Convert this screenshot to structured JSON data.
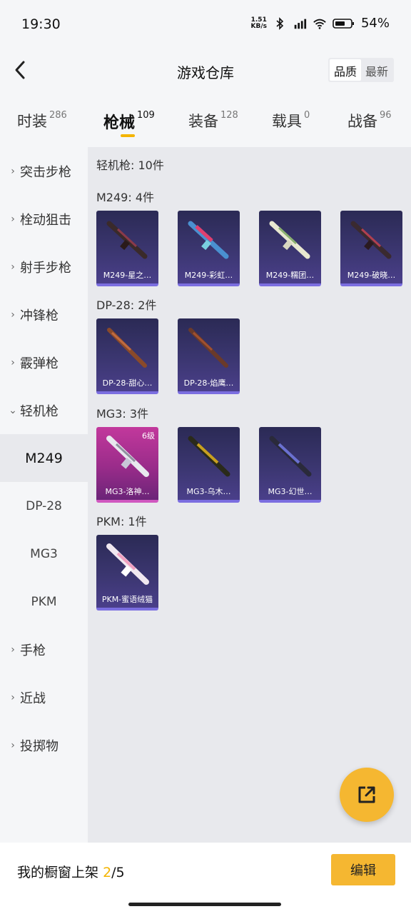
{
  "status_bar": {
    "time": "19:30",
    "net_speed_value": "1.51",
    "net_speed_unit": "KB/s",
    "battery": "54%",
    "icons": [
      "bluetooth-icon",
      "hd-signal-icon",
      "wifi-icon",
      "battery-icon"
    ]
  },
  "header": {
    "title": "游戏仓库",
    "sort_options": [
      "品质",
      "最新"
    ],
    "sort_selected": "品质"
  },
  "tabs": [
    {
      "label": "时装",
      "count": "286"
    },
    {
      "label": "枪械",
      "count": "109"
    },
    {
      "label": "装备",
      "count": "128"
    },
    {
      "label": "载具",
      "count": "0"
    },
    {
      "label": "战备",
      "count": "96"
    }
  ],
  "active_tab": "枪械",
  "sidebar": {
    "items": [
      {
        "label": "突击步枪",
        "type": "category",
        "expanded": false
      },
      {
        "label": "栓动狙击",
        "type": "category",
        "expanded": false
      },
      {
        "label": "射手步枪",
        "type": "category",
        "expanded": false
      },
      {
        "label": "冲锋枪",
        "type": "category",
        "expanded": false
      },
      {
        "label": "霰弹枪",
        "type": "category",
        "expanded": false
      },
      {
        "label": "轻机枪",
        "type": "category",
        "expanded": true
      },
      {
        "label": "M249",
        "type": "sub",
        "selected": true
      },
      {
        "label": "DP-28",
        "type": "sub"
      },
      {
        "label": "MG3",
        "type": "sub"
      },
      {
        "label": "PKM",
        "type": "sub"
      },
      {
        "label": "手枪",
        "type": "category",
        "expanded": false
      },
      {
        "label": "近战",
        "type": "category",
        "expanded": false
      },
      {
        "label": "投掷物",
        "type": "category",
        "expanded": false
      }
    ]
  },
  "content": {
    "summary": "轻机枪: 10件",
    "groups": [
      {
        "title": "M249: 4件",
        "items": [
          {
            "name": "M249-星之…",
            "rarity": "epic"
          },
          {
            "name": "M249-彩虹…",
            "rarity": "epic"
          },
          {
            "name": "M249-糯团…",
            "rarity": "epic"
          },
          {
            "name": "M249-破晓…",
            "rarity": "epic"
          }
        ]
      },
      {
        "title": "DP-28: 2件",
        "items": [
          {
            "name": "DP-28-甜心…",
            "rarity": "epic"
          },
          {
            "name": "DP-28-焰鹰…",
            "rarity": "epic"
          }
        ]
      },
      {
        "title": "MG3: 3件",
        "items": [
          {
            "name": "MG3-洛神…",
            "rarity": "legendary",
            "badge": "6级"
          },
          {
            "name": "MG3-乌木…",
            "rarity": "epic"
          },
          {
            "name": "MG3-幻世…",
            "rarity": "epic"
          }
        ]
      },
      {
        "title": "PKM: 1件",
        "items": [
          {
            "name": "PKM-蜜语绒猫",
            "rarity": "epic"
          }
        ]
      }
    ]
  },
  "fab": {
    "icon": "share-export-icon"
  },
  "bottom_bar": {
    "showcase_label": "我的橱窗上架",
    "showcase_current": "2",
    "showcase_total": "/5",
    "edit_label": "编辑"
  },
  "colors": {
    "accent": "#f5b731",
    "epic_card": "#3b3670",
    "legendary_card": "#c2389c"
  }
}
